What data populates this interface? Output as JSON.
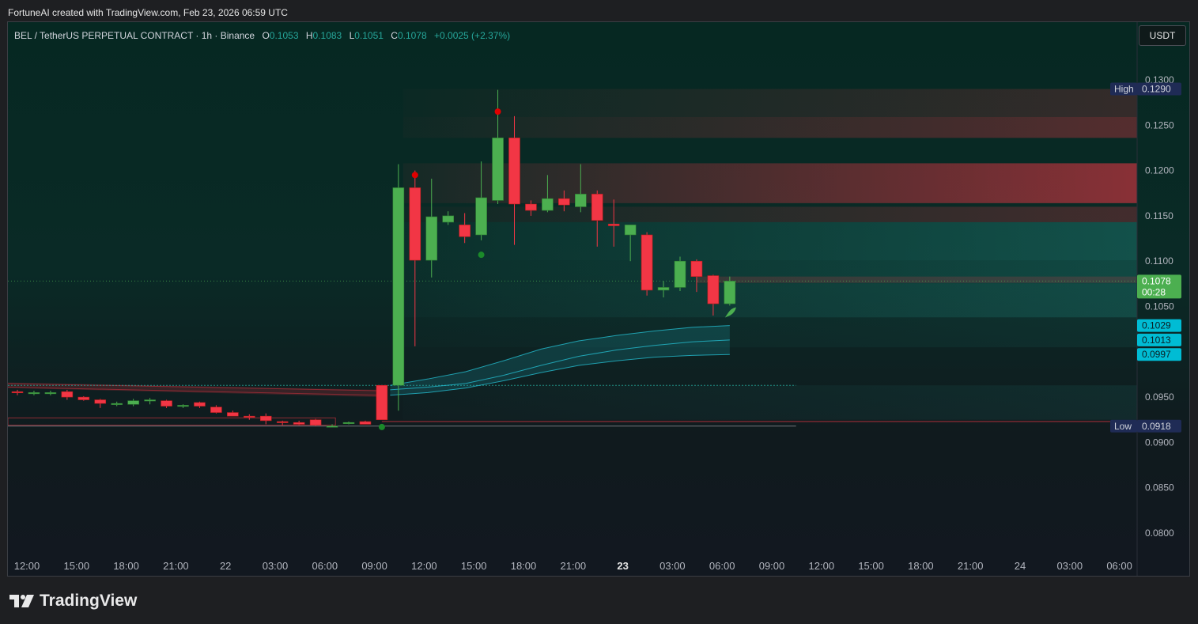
{
  "header": {
    "attribution": "FortuneAI created with TradingView.com, Feb 23, 2026 06:59 UTC"
  },
  "legend": {
    "symbol": "BEL / TetherUS PERPETUAL CONTRACT · 1h · Binance",
    "o_label": "O",
    "o": "0.1053",
    "h_label": "H",
    "h": "0.1083",
    "l_label": "L",
    "l": "0.1051",
    "c_label": "C",
    "c": "0.1078",
    "change": "+0.0025 (+2.37%)"
  },
  "currency_button": "USDT",
  "brand": {
    "name": "TradingView"
  },
  "colors": {
    "up": "#4caf50",
    "down": "#f23645",
    "accent": "#26a69a",
    "band": "#26c6da",
    "high_low_badge": "#1f2b55"
  },
  "chart_data": {
    "type": "candlestick",
    "timeframe": "1h",
    "ylim": [
      0.0775,
      0.1325
    ],
    "y_ticks": [
      "0.1300",
      "0.1250",
      "0.1200",
      "0.1150",
      "0.1100",
      "0.1050",
      "0.0950",
      "0.0900",
      "0.0850",
      "0.0800"
    ],
    "x_ticks": [
      "12:00",
      "15:00",
      "18:00",
      "21:00",
      "22",
      "03:00",
      "06:00",
      "09:00",
      "12:00",
      "15:00",
      "18:00",
      "21:00",
      "23",
      "03:00",
      "06:00",
      "09:00",
      "12:00",
      "15:00",
      "18:00",
      "21:00",
      "24",
      "03:00",
      "06:00"
    ],
    "candles": [
      [
        0.0956,
        0.0958,
        0.0952,
        0.0955
      ],
      [
        0.0955,
        0.0957,
        0.0952,
        0.0955
      ],
      [
        0.0954,
        0.0957,
        0.0952,
        0.0955
      ],
      [
        0.0956,
        0.0958,
        0.0947,
        0.095
      ],
      [
        0.095,
        0.0951,
        0.0946,
        0.0947
      ],
      [
        0.0947,
        0.0948,
        0.0938,
        0.0943
      ],
      [
        0.0942,
        0.0945,
        0.094,
        0.0943
      ],
      [
        0.0942,
        0.0948,
        0.094,
        0.0946
      ],
      [
        0.0946,
        0.0949,
        0.0942,
        0.0947
      ],
      [
        0.0946,
        0.0947,
        0.0938,
        0.094
      ],
      [
        0.094,
        0.0942,
        0.0938,
        0.0941
      ],
      [
        0.0944,
        0.0945,
        0.0938,
        0.094
      ],
      [
        0.0939,
        0.0941,
        0.0932,
        0.0933
      ],
      [
        0.0933,
        0.0935,
        0.0929,
        0.0929
      ],
      [
        0.0929,
        0.0931,
        0.0925,
        0.0928
      ],
      [
        0.0929,
        0.0932,
        0.092,
        0.0924
      ],
      [
        0.0923,
        0.0924,
        0.0919,
        0.0922
      ],
      [
        0.0922,
        0.0924,
        0.0919,
        0.092
      ],
      [
        0.0925,
        0.0926,
        0.0918,
        0.0919
      ],
      [
        0.0918,
        0.092,
        0.0917,
        0.0918
      ],
      [
        0.0921,
        0.0923,
        0.092,
        0.0922
      ],
      [
        0.0923,
        0.0924,
        0.092,
        0.092
      ],
      [
        0.0963,
        0.0963,
        0.0925,
        0.0925
      ],
      [
        0.0963,
        0.1207,
        0.0935,
        0.1181
      ],
      [
        0.1181,
        0.12,
        0.1006,
        0.1101
      ],
      [
        0.1101,
        0.1191,
        0.1082,
        0.1149
      ],
      [
        0.1143,
        0.1155,
        0.114,
        0.115
      ],
      [
        0.114,
        0.1153,
        0.112,
        0.1127
      ],
      [
        0.1129,
        0.121,
        0.1123,
        0.117
      ],
      [
        0.1167,
        0.1289,
        0.1163,
        0.1236
      ],
      [
        0.1236,
        0.126,
        0.1118,
        0.1163
      ],
      [
        0.1163,
        0.1167,
        0.115,
        0.1156
      ],
      [
        0.1156,
        0.1195,
        0.1154,
        0.1169
      ],
      [
        0.1169,
        0.1178,
        0.1155,
        0.1162
      ],
      [
        0.116,
        0.1207,
        0.1154,
        0.1174
      ],
      [
        0.1174,
        0.1178,
        0.1116,
        0.1145
      ],
      [
        0.1141,
        0.1168,
        0.1116,
        0.1139
      ],
      [
        0.1129,
        0.114,
        0.11,
        0.114
      ],
      [
        0.1129,
        0.1132,
        0.1062,
        0.1068
      ],
      [
        0.1068,
        0.1078,
        0.106,
        0.1071
      ],
      [
        0.1071,
        0.1105,
        0.1067,
        0.11
      ],
      [
        0.11,
        0.1102,
        0.1066,
        0.1083
      ],
      [
        0.1084,
        0.1085,
        0.104,
        0.1053
      ],
      [
        0.1053,
        0.1083,
        0.1051,
        0.1078
      ]
    ],
    "moving_average_band": {
      "upper": [
        0.0963,
        0.097,
        0.0978,
        0.099,
        0.1003,
        0.1012,
        0.1018,
        0.1023,
        0.1027,
        0.1029
      ],
      "middle": [
        0.0958,
        0.0961,
        0.0965,
        0.0974,
        0.0985,
        0.0995,
        0.1002,
        0.1007,
        0.1011,
        0.1013
      ],
      "lower": [
        0.0952,
        0.0955,
        0.096,
        0.0968,
        0.0977,
        0.0985,
        0.099,
        0.0994,
        0.0996,
        0.0997
      ]
    },
    "signals": {
      "sell_dots": [
        [
          24,
          0.1195
        ],
        [
          29,
          0.1265
        ]
      ],
      "buy_dots": [
        [
          22,
          0.0917
        ],
        [
          28,
          0.1107
        ]
      ],
      "rocket_at": [
        43,
        0.1043
      ]
    },
    "labels": {
      "high_word": "High",
      "high": "0.1290",
      "low_word": "Low",
      "low": "0.0918",
      "last": "0.1078",
      "countdown": "00:28",
      "band_upper": "0.1029",
      "band_middle": "0.1013",
      "band_lower": "0.0997"
    },
    "grid": false
  }
}
